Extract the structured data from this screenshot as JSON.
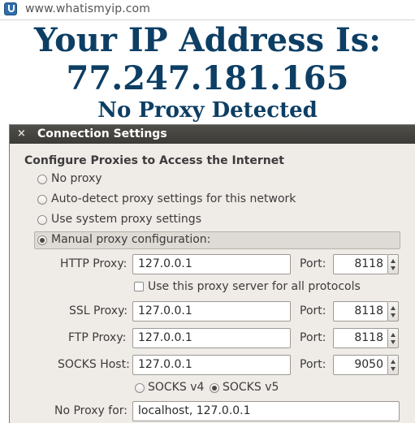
{
  "browser": {
    "url": "www.whatismyip.com"
  },
  "page": {
    "headline": "Your IP Address Is:",
    "ip": "77.247.181.165",
    "proxy_status": "No Proxy Detected"
  },
  "dialog": {
    "title": "Connection Settings",
    "close_glyph": "×",
    "section_title": "Configure Proxies to Access the Internet",
    "options": [
      {
        "label": "No proxy",
        "selected": false
      },
      {
        "label": "Auto-detect proxy settings for this network",
        "selected": false
      },
      {
        "label": "Use system proxy settings",
        "selected": false
      },
      {
        "label": "Manual proxy configuration:",
        "selected": true
      }
    ],
    "http": {
      "label": "HTTP Proxy:",
      "host": "127.0.0.1",
      "port_label": "Port:",
      "port": "8118"
    },
    "use_for_all": {
      "label": "Use this proxy server for all protocols",
      "checked": false
    },
    "ssl": {
      "label": "SSL Proxy:",
      "host": "127.0.0.1",
      "port_label": "Port:",
      "port": "8118"
    },
    "ftp": {
      "label": "FTP Proxy:",
      "host": "127.0.0.1",
      "port_label": "Port:",
      "port": "8118"
    },
    "socks": {
      "label": "SOCKS Host:",
      "host": "127.0.0.1",
      "port_label": "Port:",
      "port": "9050"
    },
    "socks_versions": [
      {
        "label": "SOCKS v4",
        "selected": false
      },
      {
        "label": "SOCKS v5",
        "selected": true
      }
    ],
    "no_proxy": {
      "label": "No Proxy for:",
      "value": "localhost, 127.0.0.1"
    }
  },
  "colors": {
    "headline": "#0d3e64",
    "titlebar": "#3c3b37",
    "dialog_bg": "#efebe7"
  }
}
